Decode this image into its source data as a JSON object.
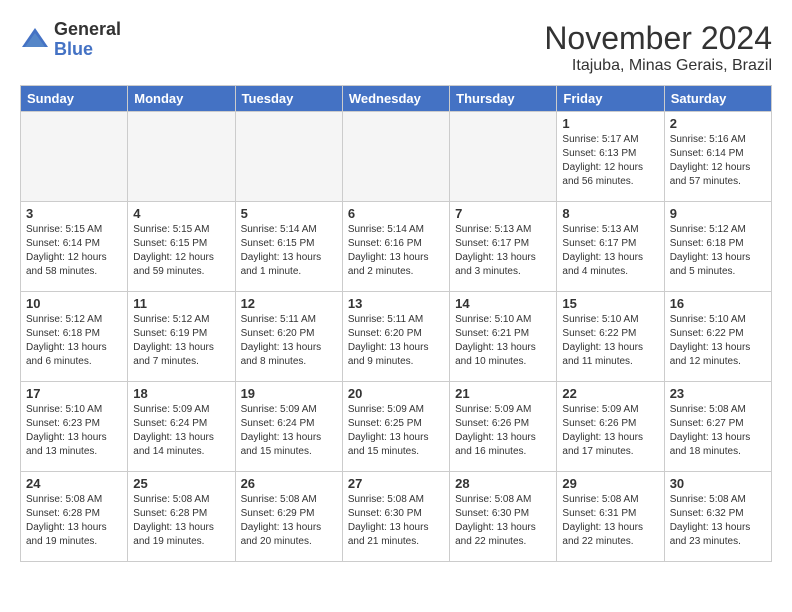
{
  "header": {
    "logo_general": "General",
    "logo_blue": "Blue",
    "month_title": "November 2024",
    "location": "Itajuba, Minas Gerais, Brazil"
  },
  "weekdays": [
    "Sunday",
    "Monday",
    "Tuesday",
    "Wednesday",
    "Thursday",
    "Friday",
    "Saturday"
  ],
  "weeks": [
    [
      {
        "day": "",
        "empty": true
      },
      {
        "day": "",
        "empty": true
      },
      {
        "day": "",
        "empty": true
      },
      {
        "day": "",
        "empty": true
      },
      {
        "day": "",
        "empty": true
      },
      {
        "day": "1",
        "sunrise": "Sunrise: 5:17 AM",
        "sunset": "Sunset: 6:13 PM",
        "daylight": "Daylight: 12 hours and 56 minutes."
      },
      {
        "day": "2",
        "sunrise": "Sunrise: 5:16 AM",
        "sunset": "Sunset: 6:14 PM",
        "daylight": "Daylight: 12 hours and 57 minutes."
      }
    ],
    [
      {
        "day": "3",
        "sunrise": "Sunrise: 5:15 AM",
        "sunset": "Sunset: 6:14 PM",
        "daylight": "Daylight: 12 hours and 58 minutes."
      },
      {
        "day": "4",
        "sunrise": "Sunrise: 5:15 AM",
        "sunset": "Sunset: 6:15 PM",
        "daylight": "Daylight: 12 hours and 59 minutes."
      },
      {
        "day": "5",
        "sunrise": "Sunrise: 5:14 AM",
        "sunset": "Sunset: 6:15 PM",
        "daylight": "Daylight: 13 hours and 1 minute."
      },
      {
        "day": "6",
        "sunrise": "Sunrise: 5:14 AM",
        "sunset": "Sunset: 6:16 PM",
        "daylight": "Daylight: 13 hours and 2 minutes."
      },
      {
        "day": "7",
        "sunrise": "Sunrise: 5:13 AM",
        "sunset": "Sunset: 6:17 PM",
        "daylight": "Daylight: 13 hours and 3 minutes."
      },
      {
        "day": "8",
        "sunrise": "Sunrise: 5:13 AM",
        "sunset": "Sunset: 6:17 PM",
        "daylight": "Daylight: 13 hours and 4 minutes."
      },
      {
        "day": "9",
        "sunrise": "Sunrise: 5:12 AM",
        "sunset": "Sunset: 6:18 PM",
        "daylight": "Daylight: 13 hours and 5 minutes."
      }
    ],
    [
      {
        "day": "10",
        "sunrise": "Sunrise: 5:12 AM",
        "sunset": "Sunset: 6:18 PM",
        "daylight": "Daylight: 13 hours and 6 minutes."
      },
      {
        "day": "11",
        "sunrise": "Sunrise: 5:12 AM",
        "sunset": "Sunset: 6:19 PM",
        "daylight": "Daylight: 13 hours and 7 minutes."
      },
      {
        "day": "12",
        "sunrise": "Sunrise: 5:11 AM",
        "sunset": "Sunset: 6:20 PM",
        "daylight": "Daylight: 13 hours and 8 minutes."
      },
      {
        "day": "13",
        "sunrise": "Sunrise: 5:11 AM",
        "sunset": "Sunset: 6:20 PM",
        "daylight": "Daylight: 13 hours and 9 minutes."
      },
      {
        "day": "14",
        "sunrise": "Sunrise: 5:10 AM",
        "sunset": "Sunset: 6:21 PM",
        "daylight": "Daylight: 13 hours and 10 minutes."
      },
      {
        "day": "15",
        "sunrise": "Sunrise: 5:10 AM",
        "sunset": "Sunset: 6:22 PM",
        "daylight": "Daylight: 13 hours and 11 minutes."
      },
      {
        "day": "16",
        "sunrise": "Sunrise: 5:10 AM",
        "sunset": "Sunset: 6:22 PM",
        "daylight": "Daylight: 13 hours and 12 minutes."
      }
    ],
    [
      {
        "day": "17",
        "sunrise": "Sunrise: 5:10 AM",
        "sunset": "Sunset: 6:23 PM",
        "daylight": "Daylight: 13 hours and 13 minutes."
      },
      {
        "day": "18",
        "sunrise": "Sunrise: 5:09 AM",
        "sunset": "Sunset: 6:24 PM",
        "daylight": "Daylight: 13 hours and 14 minutes."
      },
      {
        "day": "19",
        "sunrise": "Sunrise: 5:09 AM",
        "sunset": "Sunset: 6:24 PM",
        "daylight": "Daylight: 13 hours and 15 minutes."
      },
      {
        "day": "20",
        "sunrise": "Sunrise: 5:09 AM",
        "sunset": "Sunset: 6:25 PM",
        "daylight": "Daylight: 13 hours and 15 minutes."
      },
      {
        "day": "21",
        "sunrise": "Sunrise: 5:09 AM",
        "sunset": "Sunset: 6:26 PM",
        "daylight": "Daylight: 13 hours and 16 minutes."
      },
      {
        "day": "22",
        "sunrise": "Sunrise: 5:09 AM",
        "sunset": "Sunset: 6:26 PM",
        "daylight": "Daylight: 13 hours and 17 minutes."
      },
      {
        "day": "23",
        "sunrise": "Sunrise: 5:08 AM",
        "sunset": "Sunset: 6:27 PM",
        "daylight": "Daylight: 13 hours and 18 minutes."
      }
    ],
    [
      {
        "day": "24",
        "sunrise": "Sunrise: 5:08 AM",
        "sunset": "Sunset: 6:28 PM",
        "daylight": "Daylight: 13 hours and 19 minutes."
      },
      {
        "day": "25",
        "sunrise": "Sunrise: 5:08 AM",
        "sunset": "Sunset: 6:28 PM",
        "daylight": "Daylight: 13 hours and 19 minutes."
      },
      {
        "day": "26",
        "sunrise": "Sunrise: 5:08 AM",
        "sunset": "Sunset: 6:29 PM",
        "daylight": "Daylight: 13 hours and 20 minutes."
      },
      {
        "day": "27",
        "sunrise": "Sunrise: 5:08 AM",
        "sunset": "Sunset: 6:30 PM",
        "daylight": "Daylight: 13 hours and 21 minutes."
      },
      {
        "day": "28",
        "sunrise": "Sunrise: 5:08 AM",
        "sunset": "Sunset: 6:30 PM",
        "daylight": "Daylight: 13 hours and 22 minutes."
      },
      {
        "day": "29",
        "sunrise": "Sunrise: 5:08 AM",
        "sunset": "Sunset: 6:31 PM",
        "daylight": "Daylight: 13 hours and 22 minutes."
      },
      {
        "day": "30",
        "sunrise": "Sunrise: 5:08 AM",
        "sunset": "Sunset: 6:32 PM",
        "daylight": "Daylight: 13 hours and 23 minutes."
      }
    ]
  ]
}
